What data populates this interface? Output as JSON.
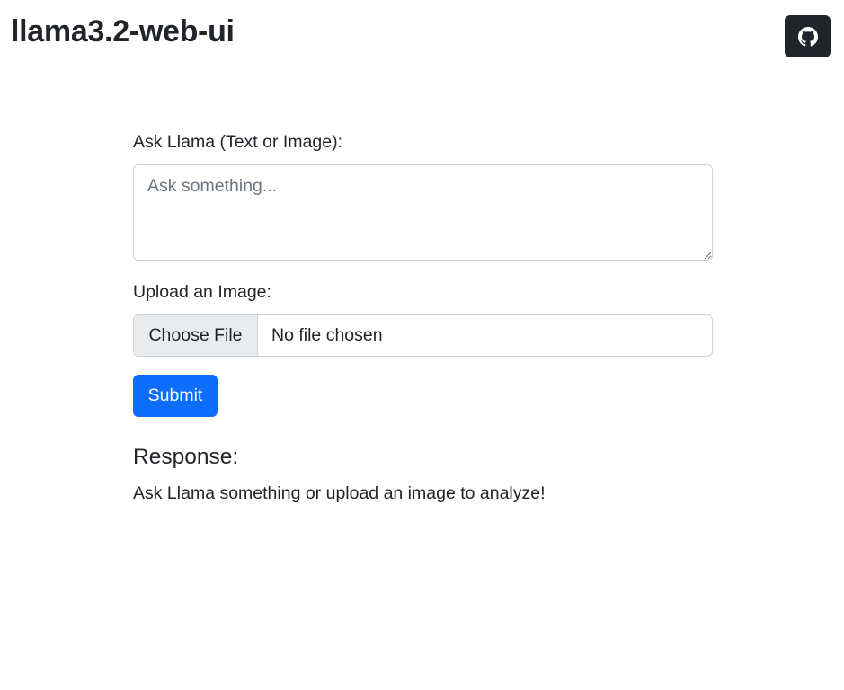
{
  "header": {
    "title": "llama3.2-web-ui",
    "github_icon": "github-icon",
    "github_button_bg": "#212529"
  },
  "form": {
    "prompt_label": "Ask Llama (Text or Image):",
    "prompt_placeholder": "Ask something...",
    "prompt_value": "",
    "upload_label": "Upload an Image:",
    "file_button_label": "Choose File",
    "file_status": "No file chosen",
    "submit_label": "Submit",
    "submit_color": "#0d6efd"
  },
  "response": {
    "heading": "Response:",
    "text": "Ask Llama something or upload an image to analyze!"
  }
}
